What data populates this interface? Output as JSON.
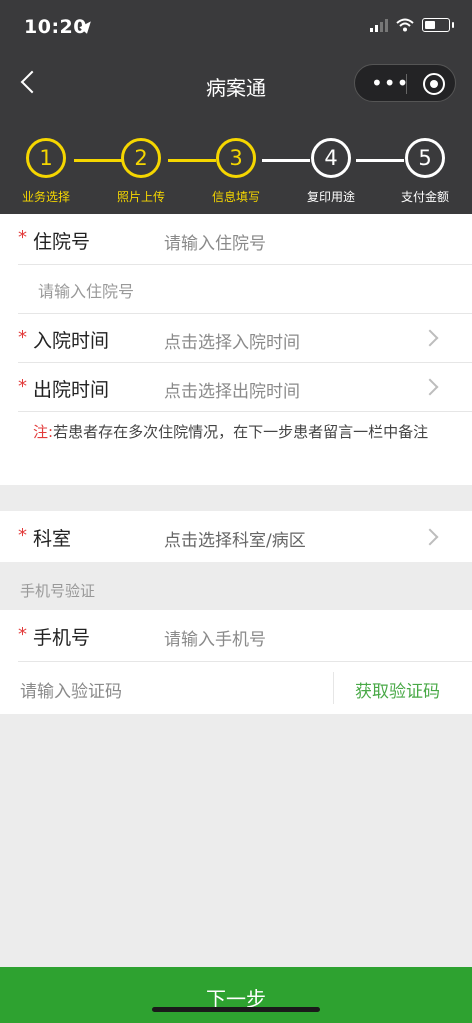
{
  "status_bar": {
    "time": "10:20"
  },
  "nav": {
    "title": "病案通"
  },
  "steps": [
    {
      "number": "1",
      "label": "业务选择",
      "active": true
    },
    {
      "number": "2",
      "label": "照片上传",
      "active": true
    },
    {
      "number": "3",
      "label": "信息填写",
      "active": true
    },
    {
      "number": "4",
      "label": "复印用途",
      "active": false
    },
    {
      "number": "5",
      "label": "支付金额",
      "active": false
    }
  ],
  "form": {
    "required_mark": "*",
    "admission_no": {
      "label": "住院号",
      "placeholder": "请输入住院号",
      "extra_placeholder": "请输入住院号"
    },
    "admission_time": {
      "label": "入院时间",
      "placeholder": "点击选择入院时间"
    },
    "discharge_time": {
      "label": "出院时间",
      "placeholder": "点击选择出院时间"
    },
    "note": {
      "prefix": "注:",
      "text": "若患者存在多次住院情况，在下一步患者留言一栏中备注"
    },
    "department": {
      "label": "科室",
      "placeholder": "点击选择科室/病区"
    },
    "phone_section": {
      "title": "手机号验证"
    },
    "phone": {
      "label": "手机号",
      "placeholder": "请输入手机号"
    },
    "verify": {
      "placeholder": "请输入验证码",
      "get_code": "获取验证码"
    }
  },
  "footer": {
    "next_label": "下一步"
  },
  "colors": {
    "accent": "#f5d600",
    "header_bg": "#3a3a3c",
    "primary_green": "#2ea230",
    "required_red": "#e23b3b"
  }
}
